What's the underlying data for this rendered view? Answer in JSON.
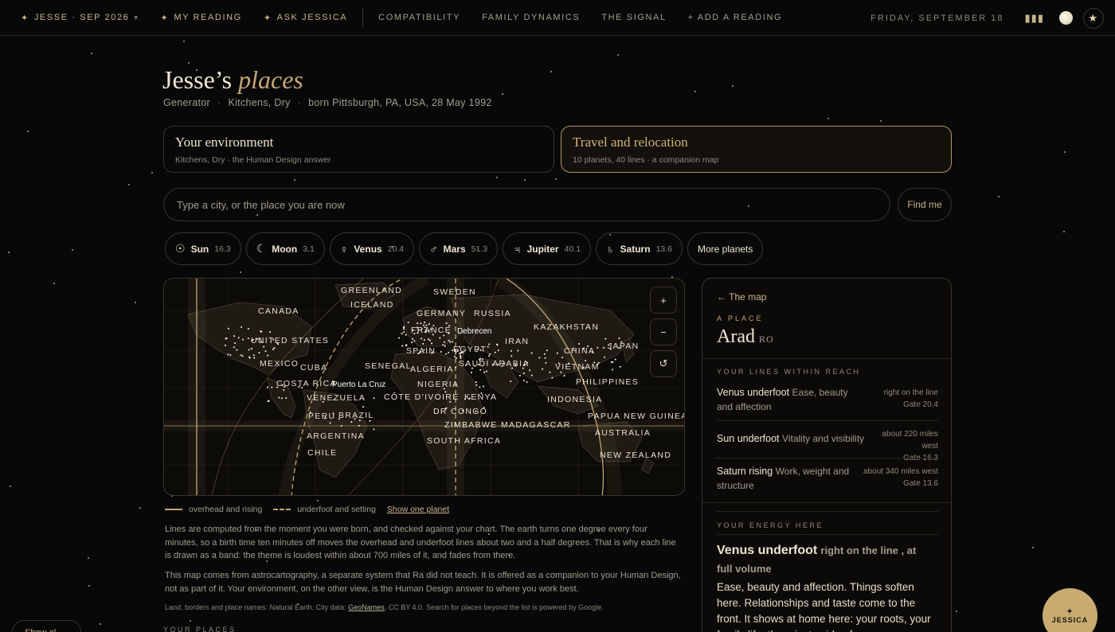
{
  "nav": {
    "profile": "JESSE · SEP 2026",
    "my_reading": "MY READING",
    "ask": "ASK JESSICA",
    "compatibility": "COMPATIBILITY",
    "family": "FAMILY DYNAMICS",
    "signal": "THE SIGNAL",
    "add_reading": "+ ADD A READING",
    "date": "FRIDAY, SEPTEMBER 18",
    "spark": "✦",
    "chev": "▾"
  },
  "header": {
    "title_a": "Jesse’s",
    "title_b": "places",
    "type": "Generator",
    "environment": "Kitchens, Dry",
    "born": "born Pittsburgh, PA, USA, 28 May 1992",
    "sep": "·"
  },
  "cards": [
    {
      "title": "Your environment",
      "sub": "Kitchens, Dry · the Human Design answer"
    },
    {
      "title": "Travel and relocation",
      "sub": "10 planets, 40 lines · a companion map"
    }
  ],
  "search": {
    "placeholder": "Type a city, or the place you are now",
    "button": "Find me"
  },
  "planets": [
    {
      "sym": "☉",
      "name": "Sun",
      "val": "16.3"
    },
    {
      "sym": "☾",
      "name": "Moon",
      "val": "3.1"
    },
    {
      "sym": "♀",
      "name": "Venus",
      "val": "20.4"
    },
    {
      "sym": "♂",
      "name": "Mars",
      "val": "51.3"
    },
    {
      "sym": "♃",
      "name": "Jupiter",
      "val": "40.1"
    },
    {
      "sym": "♄",
      "name": "Saturn",
      "val": "13.6"
    },
    {
      "name": "More planets"
    }
  ],
  "map": {
    "labels": [
      "GREENLAND",
      "SWEDEN",
      "ICELAND",
      "CANADA",
      "GERMANY",
      "RUSSIA",
      "FRANCE",
      "KAZAKHSTAN",
      "UNITED STATES",
      "SPAIN",
      "EGYPT",
      "IRAN",
      "JAPAN",
      "CHINA",
      "MEXICO",
      "CUBA",
      "SENEGAL",
      "ALGERIA",
      "SAUDI ARABIA",
      "VIETNAM",
      "COSTA RICA",
      "NIGERIA",
      "PHILIPPINES",
      "VENEZUELA",
      "CÔTE D’IVOIRE",
      "KENYA",
      "INDONESIA",
      "PERU",
      "BRAZIL",
      "DR CONGO",
      "PAPUA NEW GUINEA",
      "ZIMBABWE",
      "MADAGASCAR",
      "AUSTRALIA",
      "ARGENTINA",
      "SOUTH AFRICA",
      "CHILE",
      "NEW ZEALAND"
    ],
    "cities": [
      "Debrecen",
      "Puerto La Cruz"
    ],
    "zoom_in": "+",
    "zoom_out": "−",
    "reset": "↺"
  },
  "legend": {
    "solid": "overhead and rising",
    "dashed": "underfoot and setting",
    "link": "Show one planet"
  },
  "notes": {
    "p1": "Lines are computed from the moment you were born, and checked against your chart. The earth turns one degree every four minutes, so a birth time ten minutes off moves the overhead and underfoot lines about two and a half degrees. That is why each line is drawn as a band: the theme is loudest within about 700 miles of it, and fades from there.",
    "p2": "This map comes from astrocartography, a separate system that Ra did not teach. It is offered as a companion to your Human Design, not as part of it. Your environment, on the other view, is the Human Design answer to where you work best.",
    "credit_a": "Land, borders and place names: Natural Earth. City data:",
    "credit_link": "GeoNames",
    "credit_b": ", CC BY 4.0. Search for places beyond the list is powered by Google.",
    "places_heading": "YOUR PLACES",
    "show_all": "Show al..."
  },
  "panel": {
    "back": "← The map",
    "kicker": "A PLACE",
    "place": "Arad",
    "country": "RO",
    "lines_heading": "YOUR LINES WITHIN REACH",
    "lines": [
      {
        "title": "Venus underfoot",
        "desc": "Ease, beauty and affection",
        "dist": "right on the line",
        "gate": "Gate 20.4"
      },
      {
        "title": "Sun underfoot",
        "desc": "Vitality and visibility",
        "dist": "about 220 miles west",
        "gate": "Gate 16.3"
      },
      {
        "title": "Saturn rising",
        "desc": "Work, weight and structure",
        "dist": "about 340 miles west",
        "gate": "Gate 13.6"
      }
    ],
    "energy_heading": "YOUR ENERGY HERE",
    "energy_title": "Venus underfoot",
    "energy_qual": "right on the line , at full volume",
    "energy_text": "Ease, beauty and affection. Things soften here. Relationships and taste come to the front. It shows at home here: your roots, your family life, the private side of..."
  },
  "jessica": {
    "spark": "✦",
    "label": "JESSICA"
  },
  "colors": {
    "accent": "#c4a574",
    "bg": "#080808",
    "border": "#3a3428"
  }
}
